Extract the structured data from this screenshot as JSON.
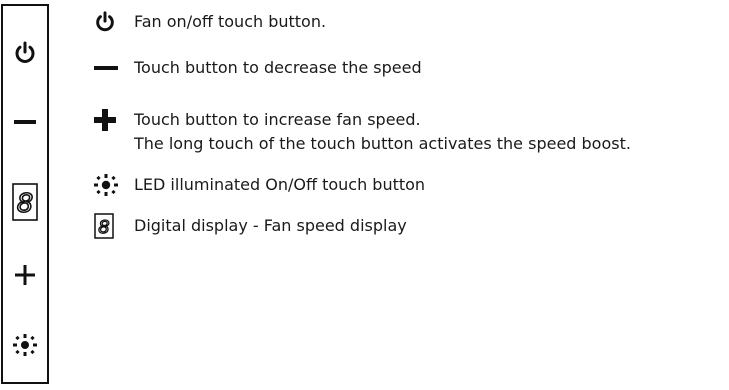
{
  "legend": [
    {
      "icon": "power-icon",
      "lines": [
        "Fan on/off touch button."
      ]
    },
    {
      "icon": "minus-icon",
      "lines": [
        "Touch button to decrease the speed"
      ]
    },
    {
      "icon": "plus-icon",
      "lines": [
        "Touch button to increase fan speed.",
        "The long touch of the touch button activates the speed boost."
      ]
    },
    {
      "icon": "light-icon",
      "lines": [
        "LED illuminated On/Off touch button"
      ]
    },
    {
      "icon": "digit-display-icon",
      "lines": [
        "Digital display - Fan speed display"
      ]
    }
  ],
  "panel": {
    "buttons": [
      "power-icon",
      "minus-icon",
      "digit-display-icon",
      "plus-icon",
      "light-icon"
    ],
    "display_digit": "8"
  }
}
